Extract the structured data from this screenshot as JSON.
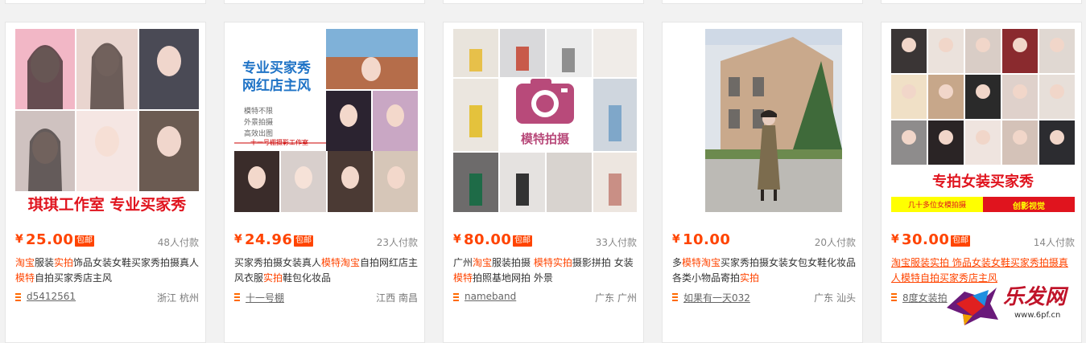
{
  "currency_symbol": "¥",
  "baoyou_label": "包邮",
  "colors": {
    "accent": "#ff4400",
    "shop_icon": "#ff6a00"
  },
  "products": [
    {
      "price": "25.00",
      "sold": "48人付款",
      "title_parts": [
        {
          "text": "淘宝",
          "hl": true
        },
        {
          "text": "服装",
          "hl": false
        },
        {
          "text": "实拍",
          "hl": true
        },
        {
          "text": "饰品女装女鞋买家秀拍摄真人",
          "hl": false
        },
        {
          "text": "模特",
          "hl": true
        },
        {
          "text": "自拍买家秀店主风",
          "hl": false
        }
      ],
      "shop": "d5412561",
      "location": "浙江 杭州",
      "image_text": [
        "琪琪工作室 专业买家秀"
      ]
    },
    {
      "price": "24.96",
      "sold": "23人付款",
      "title_parts": [
        {
          "text": "买家秀拍摄女装真人",
          "hl": false
        },
        {
          "text": "模特淘宝",
          "hl": true
        },
        {
          "text": "自拍网红店主风衣服",
          "hl": false
        },
        {
          "text": "实拍",
          "hl": true
        },
        {
          "text": "鞋包化妆品",
          "hl": false
        }
      ],
      "shop": "十一号棚",
      "location": "江西 南昌",
      "image_text": [
        "专业买家秀",
        "网红店主风",
        "模特不限",
        "外景拍摄",
        "高效出图",
        "十一号棚摄影工作室"
      ]
    },
    {
      "price": "80.00",
      "sold": "33人付款",
      "title_parts": [
        {
          "text": "广州",
          "hl": false
        },
        {
          "text": "淘宝",
          "hl": true
        },
        {
          "text": "服装拍摄 ",
          "hl": false
        },
        {
          "text": "模特实拍",
          "hl": true
        },
        {
          "text": "摄影拼拍 女装",
          "hl": false
        },
        {
          "text": "模特",
          "hl": true
        },
        {
          "text": "拍照基地网拍 外景",
          "hl": false
        }
      ],
      "shop": "nameband",
      "location": "广东 广州",
      "image_text": [
        "模特拍摄"
      ]
    },
    {
      "price": "10.00",
      "sold": "20人付款",
      "title_parts": [
        {
          "text": "多",
          "hl": false
        },
        {
          "text": "模特淘宝",
          "hl": true
        },
        {
          "text": "买家秀拍摄女装女包女鞋化妆品各类小物品寄拍",
          "hl": false
        },
        {
          "text": "实拍",
          "hl": true
        }
      ],
      "shop": "如果有一天032",
      "location": "广东 汕头",
      "image_text": []
    },
    {
      "price": "30.00",
      "sold": "14人付款",
      "title_parts": [
        {
          "text": "淘宝服装实拍 饰品女装女鞋买家秀拍摄真人模特自拍买家秀店主风",
          "hl": true
        }
      ],
      "title_linked": true,
      "shop": "8度女装拍",
      "location": "",
      "image_text": [
        "专拍女装买家秀",
        "几十多位女模拍摄",
        "创影视觉"
      ]
    }
  ],
  "watermark": {
    "brand": "乐发网",
    "url": "www.6pf.cn"
  }
}
